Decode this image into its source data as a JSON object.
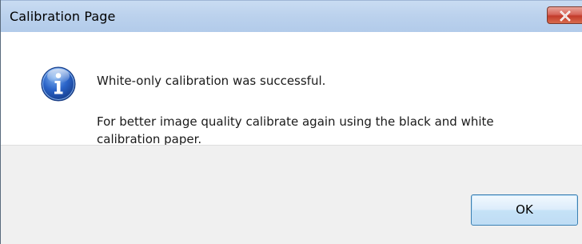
{
  "window": {
    "title": "Calibration Page"
  },
  "message": {
    "line1": "White-only calibration was successful.",
    "line2": "For better image quality calibrate again using the black and white calibration paper."
  },
  "buttons": {
    "ok_label": "OK"
  },
  "icons": {
    "dialog_icon": "info-icon",
    "close_icon": "close-icon"
  },
  "colors": {
    "titlebar": "#bcd2ed",
    "close_button": "#c33b2b",
    "ok_border": "#3c7fb1"
  }
}
